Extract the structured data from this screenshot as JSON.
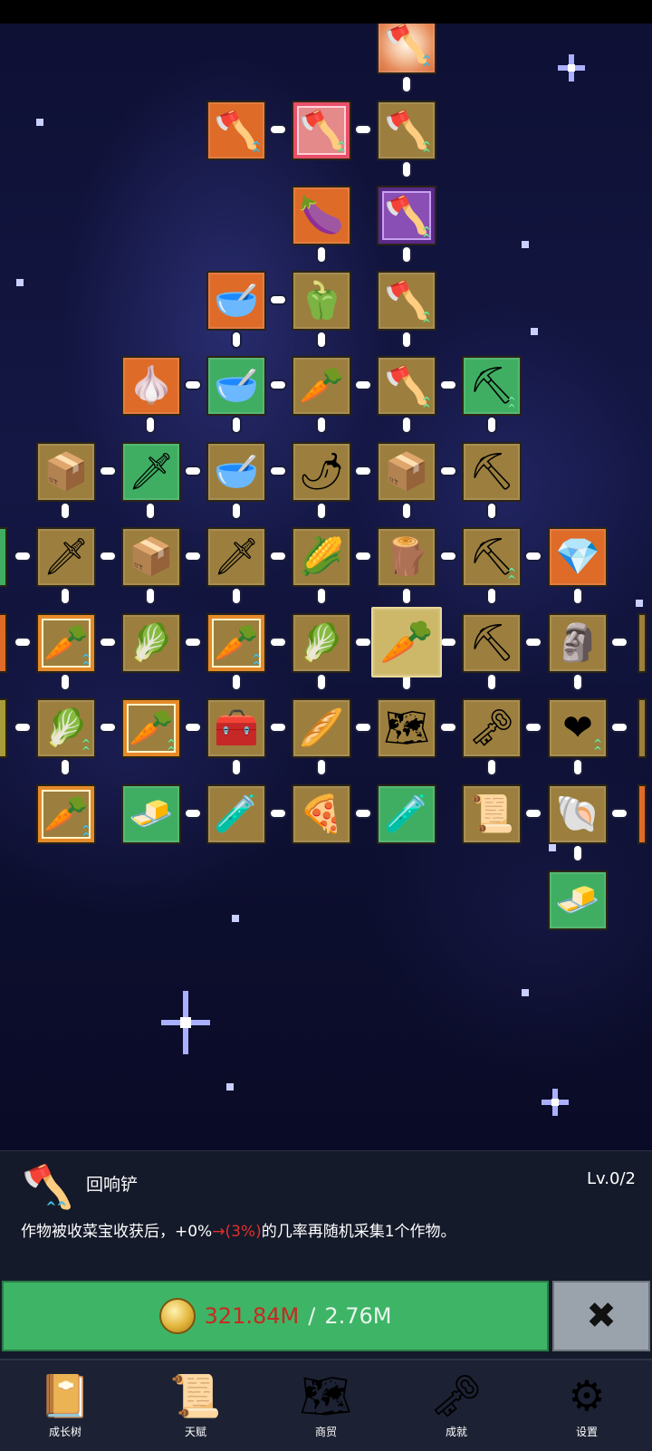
{
  "skill_tree": {
    "icons": {
      "shovel": "🪓",
      "pickaxe": "⛏",
      "sword": "🗡",
      "eggplant": "🍆",
      "pepper": "🫑",
      "chili": "🌶",
      "garlic": "🧄",
      "radish": "🥕",
      "carrot": "🥕",
      "cabbage": "🥬",
      "corn": "🌽",
      "bowl": "🥣",
      "chest": "🧰",
      "crate": "📦",
      "crystal": "💎",
      "statue": "🗿",
      "key": "🗝",
      "heart": "❤",
      "map": "🗺",
      "scroll": "📜",
      "bread": "🍞",
      "potion": "🧪",
      "pizza": "🍕",
      "fossil": "🐚",
      "gold_bar": "🧈",
      "parsnip": "🥖",
      "stick": "🪵",
      "book": "📔",
      "gear": "⚙"
    }
  },
  "info_panel": {
    "icon": "🪓",
    "title": "回响铲",
    "level": "Lv.0/2",
    "desc_prefix": "作物被收菜宝收获后，+0%",
    "desc_arrow": "→",
    "desc_new_value": "(3%)",
    "desc_suffix": "的几率再随机采集1个作物。"
  },
  "upgrade": {
    "have": "321.84M",
    "separator": " / ",
    "need": "2.76M"
  },
  "close_label": "✖",
  "bottom_nav": [
    {
      "label": "成长树",
      "icon": "📔"
    },
    {
      "label": "天赋",
      "icon": "📜"
    },
    {
      "label": "商贸",
      "icon": "🗺"
    },
    {
      "label": "成就",
      "icon": "🗝"
    },
    {
      "label": "设置",
      "icon": "⚙"
    }
  ],
  "colors": {
    "node_gold": "#9c7f3e",
    "node_orange": "#df6b29",
    "node_green": "#3fae62",
    "node_purple": "#8a4fb4",
    "upgrade_green": "#3eb566",
    "cost_red": "#c62a20"
  }
}
